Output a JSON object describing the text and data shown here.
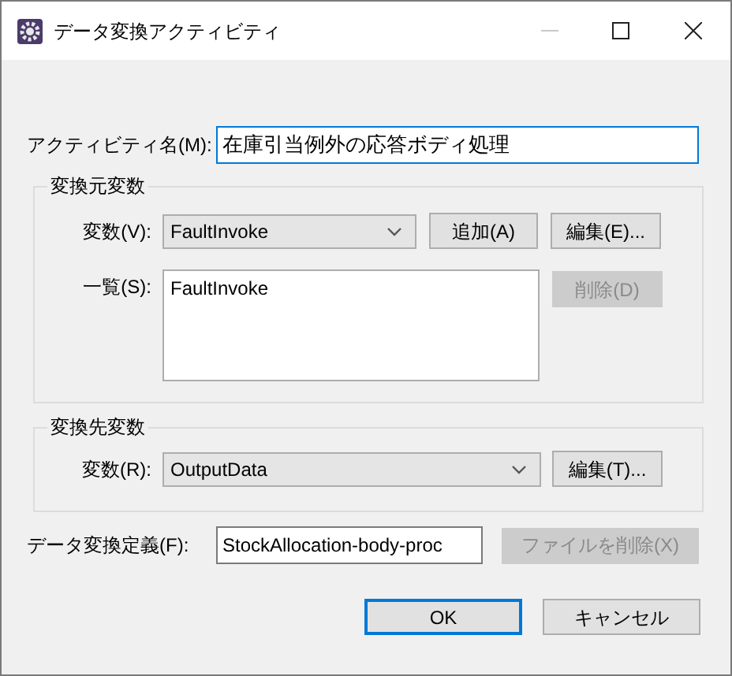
{
  "window": {
    "title": "データ変換アクティビティ"
  },
  "activity_name": {
    "label": "アクティビティ名(M):",
    "value": "在庫引当例外の応答ボディ処理"
  },
  "source_variables": {
    "title": "変換元変数",
    "variable": {
      "label": "変数(V):",
      "value": "FaultInvoke"
    },
    "buttons": [
      {
        "label": "追加(A)",
        "disabled": false
      },
      {
        "label": "編集(E)...",
        "disabled": false
      }
    ],
    "list": {
      "label": "一覧(S):",
      "items": [
        "FaultInvoke"
      ]
    },
    "remove_button": {
      "label": "削除(D)",
      "disabled": true
    }
  },
  "target_variables": {
    "title": "変換先変数",
    "variable": {
      "label": "変数(R):",
      "value": "OutputData"
    },
    "edit_button": {
      "label": "編集(T)...",
      "disabled": false
    }
  },
  "definition": {
    "label": "データ変換定義(F):",
    "value": "StockAllocation-body-proc",
    "delete_button": {
      "label": "ファイルを削除(X)",
      "disabled": true
    }
  },
  "buttons": [
    {
      "label": "OK",
      "default": true
    },
    {
      "label": "キャンセル",
      "default": false
    }
  ]
}
